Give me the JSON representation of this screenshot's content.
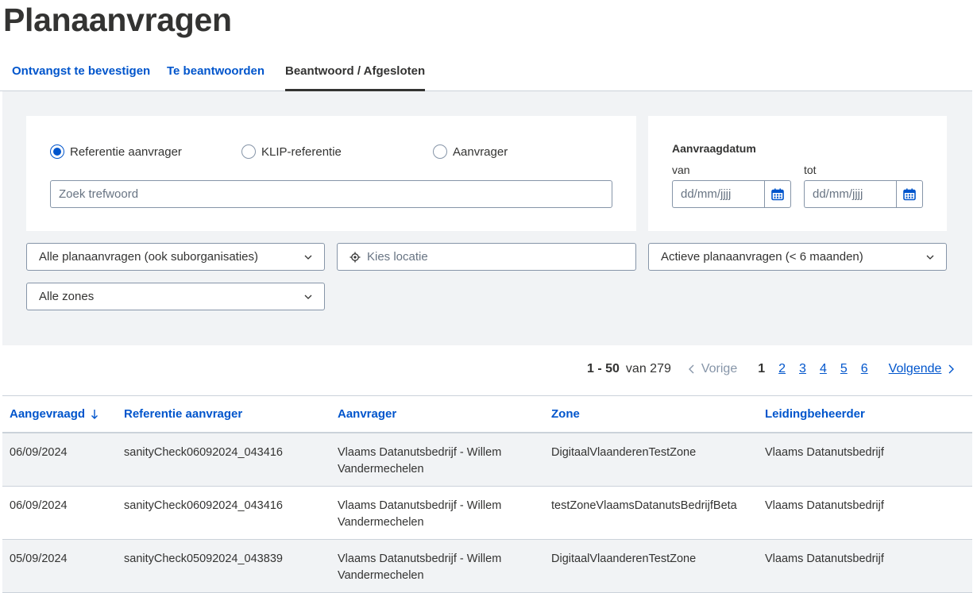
{
  "page": {
    "title": "Planaanvragen"
  },
  "tabs": [
    {
      "label": "Ontvangst te bevestigen"
    },
    {
      "label": "Te beantwoorden"
    },
    {
      "label": "Beantwoord / Afgesloten"
    }
  ],
  "search": {
    "radios": [
      {
        "label": "Referentie aanvrager",
        "checked": true
      },
      {
        "label": "KLIP-referentie",
        "checked": false
      },
      {
        "label": "Aanvrager",
        "checked": false
      }
    ],
    "keyword_placeholder": "Zoek trefwoord"
  },
  "date_filter": {
    "heading": "Aanvraagdatum",
    "from_label": "van",
    "to_label": "tot",
    "from_placeholder": "dd/mm/jjjj",
    "to_placeholder": "dd/mm/jjjj"
  },
  "filters": {
    "organisation": "Alle planaanvragen (ook suborganisaties)",
    "location_placeholder": "Kies locatie",
    "period": "Actieve planaanvragen (< 6 maanden)",
    "zones": "Alle zones"
  },
  "pagination": {
    "range": "1 - 50",
    "total": "van 279",
    "prev": "Vorige",
    "pages": [
      "1",
      "2",
      "3",
      "4",
      "5",
      "6"
    ],
    "current": "1",
    "next": "Volgende"
  },
  "table": {
    "columns": [
      "Aangevraagd",
      "Referentie aanvrager",
      "Aanvrager",
      "Zone",
      "Leidingbeheerder"
    ],
    "sort_icon": "arrow-down-icon",
    "rows": [
      [
        "06/09/2024",
        "sanityCheck06092024_043416",
        "Vlaams Datanutsbedrijf - Willem Vandermechelen",
        "DigitaalVlaanderenTestZone",
        "Vlaams Datanutsbedrijf"
      ],
      [
        "06/09/2024",
        "sanityCheck06092024_043416",
        "Vlaams Datanutsbedrijf - Willem Vandermechelen",
        "testZoneVlaamsDatanutsBedrijfBeta",
        "Vlaams Datanutsbedrijf"
      ],
      [
        "05/09/2024",
        "sanityCheck05092024_043839",
        "Vlaams Datanutsbedrijf - Willem Vandermechelen",
        "DigitaalVlaanderenTestZone",
        "Vlaams Datanutsbedrijf"
      ]
    ]
  },
  "colors": {
    "link": "#0055cc",
    "text": "#333332",
    "panel": "#f1f3f5",
    "border": "#8695a8"
  }
}
